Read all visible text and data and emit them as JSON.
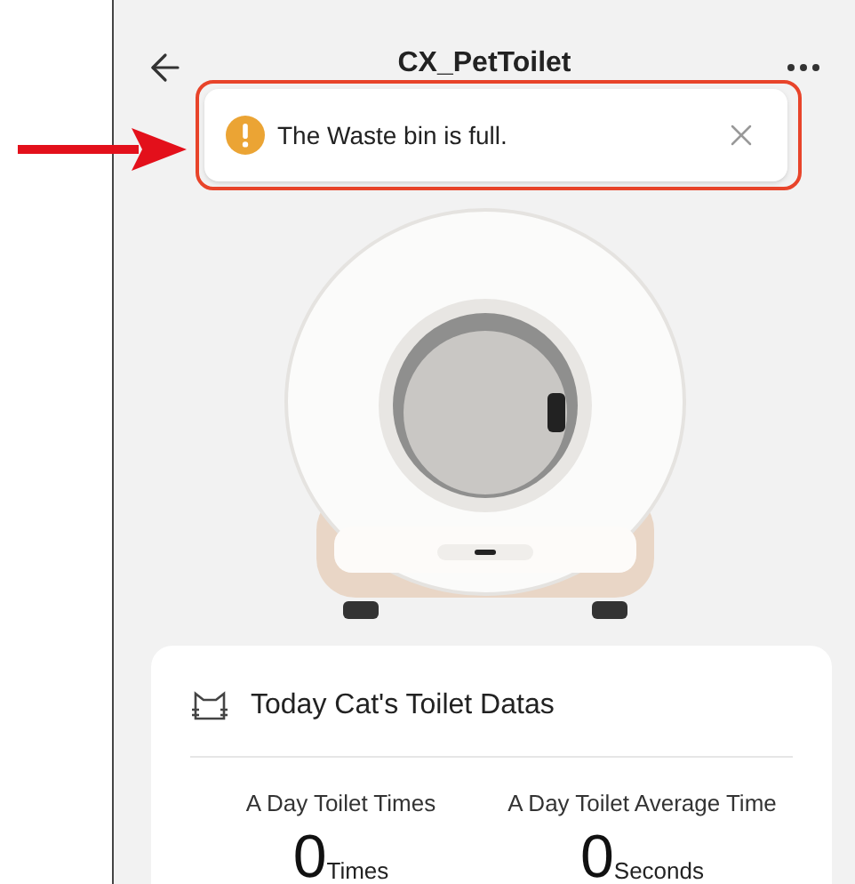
{
  "header": {
    "title": "CX_PetToilet"
  },
  "notification": {
    "message": "The Waste bin is full."
  },
  "stats_card": {
    "title": "Today Cat's Toilet Datas",
    "stats": [
      {
        "label": "A Day Toilet Times",
        "value": "0",
        "unit": "Times"
      },
      {
        "label": "A Day Toilet Average Time",
        "value": "0",
        "unit": "Seconds"
      }
    ]
  }
}
